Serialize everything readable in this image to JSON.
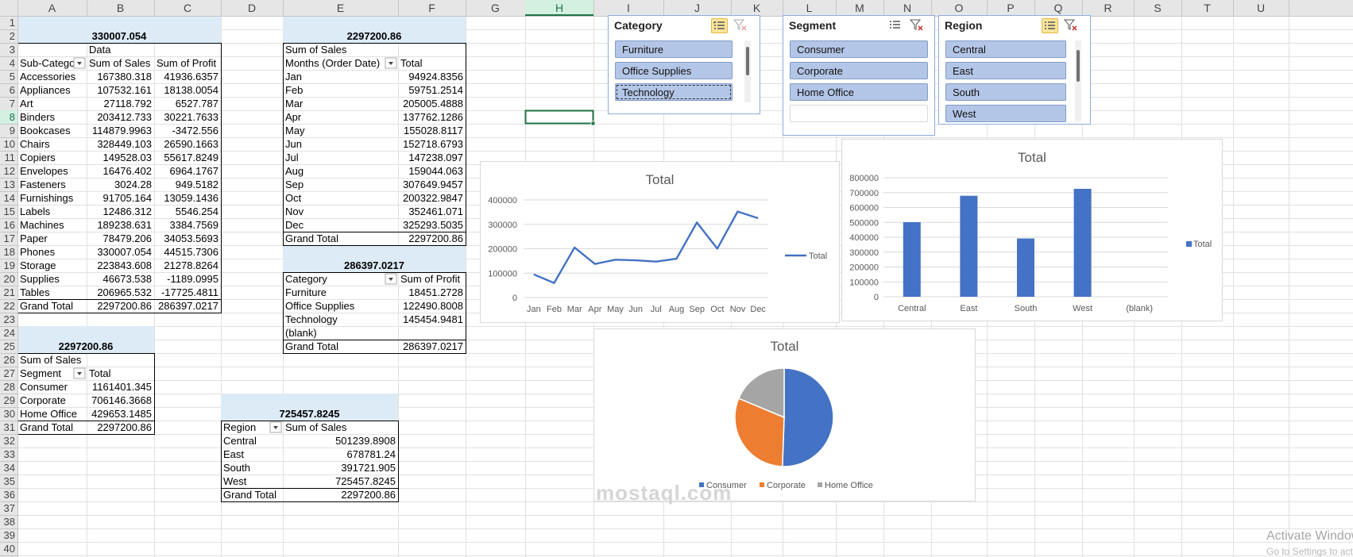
{
  "columns": [
    "A",
    "B",
    "C",
    "D",
    "E",
    "F",
    "G",
    "H",
    "I",
    "J",
    "K",
    "L",
    "M",
    "N",
    "O",
    "P",
    "Q",
    "R",
    "S",
    "T",
    "U"
  ],
  "selected": {
    "column": "H",
    "row": 8
  },
  "cells": [
    {
      "c": "B",
      "r": 2,
      "v": "330007.054",
      "b": 1,
      "al": "c"
    },
    {
      "c": "B",
      "r": 3,
      "v": "Data"
    },
    {
      "c": "A",
      "r": 4,
      "v": "Sub-Catego"
    },
    {
      "c": "B",
      "r": 4,
      "v": "Sum of Sales"
    },
    {
      "c": "C",
      "r": 4,
      "v": "Sum of Profit"
    },
    {
      "c": "A",
      "r": 5,
      "v": "Accessories"
    },
    {
      "c": "B",
      "r": 5,
      "v": "167380.318",
      "al": "r"
    },
    {
      "c": "C",
      "r": 5,
      "v": "41936.6357",
      "al": "r"
    },
    {
      "c": "A",
      "r": 6,
      "v": "Appliances"
    },
    {
      "c": "B",
      "r": 6,
      "v": "107532.161",
      "al": "r"
    },
    {
      "c": "C",
      "r": 6,
      "v": "18138.0054",
      "al": "r"
    },
    {
      "c": "A",
      "r": 7,
      "v": "Art"
    },
    {
      "c": "B",
      "r": 7,
      "v": "27118.792",
      "al": "r"
    },
    {
      "c": "C",
      "r": 7,
      "v": "6527.787",
      "al": "r"
    },
    {
      "c": "A",
      "r": 8,
      "v": "Binders"
    },
    {
      "c": "B",
      "r": 8,
      "v": "203412.733",
      "al": "r"
    },
    {
      "c": "C",
      "r": 8,
      "v": "30221.7633",
      "al": "r"
    },
    {
      "c": "A",
      "r": 9,
      "v": "Bookcases"
    },
    {
      "c": "B",
      "r": 9,
      "v": "114879.9963",
      "al": "r"
    },
    {
      "c": "C",
      "r": 9,
      "v": "-3472.556",
      "al": "r"
    },
    {
      "c": "A",
      "r": 10,
      "v": "Chairs"
    },
    {
      "c": "B",
      "r": 10,
      "v": "328449.103",
      "al": "r"
    },
    {
      "c": "C",
      "r": 10,
      "v": "26590.1663",
      "al": "r"
    },
    {
      "c": "A",
      "r": 11,
      "v": "Copiers"
    },
    {
      "c": "B",
      "r": 11,
      "v": "149528.03",
      "al": "r"
    },
    {
      "c": "C",
      "r": 11,
      "v": "55617.8249",
      "al": "r"
    },
    {
      "c": "A",
      "r": 12,
      "v": "Envelopes"
    },
    {
      "c": "B",
      "r": 12,
      "v": "16476.402",
      "al": "r"
    },
    {
      "c": "C",
      "r": 12,
      "v": "6964.1767",
      "al": "r"
    },
    {
      "c": "A",
      "r": 13,
      "v": "Fasteners"
    },
    {
      "c": "B",
      "r": 13,
      "v": "3024.28",
      "al": "r"
    },
    {
      "c": "C",
      "r": 13,
      "v": "949.5182",
      "al": "r"
    },
    {
      "c": "A",
      "r": 14,
      "v": "Furnishings"
    },
    {
      "c": "B",
      "r": 14,
      "v": "91705.164",
      "al": "r"
    },
    {
      "c": "C",
      "r": 14,
      "v": "13059.1436",
      "al": "r"
    },
    {
      "c": "A",
      "r": 15,
      "v": "Labels"
    },
    {
      "c": "B",
      "r": 15,
      "v": "12486.312",
      "al": "r"
    },
    {
      "c": "C",
      "r": 15,
      "v": "5546.254",
      "al": "r"
    },
    {
      "c": "A",
      "r": 16,
      "v": "Machines"
    },
    {
      "c": "B",
      "r": 16,
      "v": "189238.631",
      "al": "r"
    },
    {
      "c": "C",
      "r": 16,
      "v": "3384.7569",
      "al": "r"
    },
    {
      "c": "A",
      "r": 17,
      "v": "Paper"
    },
    {
      "c": "B",
      "r": 17,
      "v": "78479.206",
      "al": "r"
    },
    {
      "c": "C",
      "r": 17,
      "v": "34053.5693",
      "al": "r"
    },
    {
      "c": "A",
      "r": 18,
      "v": "Phones"
    },
    {
      "c": "B",
      "r": 18,
      "v": "330007.054",
      "al": "r"
    },
    {
      "c": "C",
      "r": 18,
      "v": "44515.7306",
      "al": "r"
    },
    {
      "c": "A",
      "r": 19,
      "v": "Storage"
    },
    {
      "c": "B",
      "r": 19,
      "v": "223843.608",
      "al": "r"
    },
    {
      "c": "C",
      "r": 19,
      "v": "21278.8264",
      "al": "r"
    },
    {
      "c": "A",
      "r": 20,
      "v": "Supplies"
    },
    {
      "c": "B",
      "r": 20,
      "v": "46673.538",
      "al": "r"
    },
    {
      "c": "C",
      "r": 20,
      "v": "-1189.0995",
      "al": "r"
    },
    {
      "c": "A",
      "r": 21,
      "v": "Tables"
    },
    {
      "c": "B",
      "r": 21,
      "v": "206965.532",
      "al": "r"
    },
    {
      "c": "C",
      "r": 21,
      "v": "-17725.4811",
      "al": "r"
    },
    {
      "c": "A",
      "r": 22,
      "v": "Grand Total"
    },
    {
      "c": "B",
      "r": 22,
      "v": "2297200.86",
      "al": "r"
    },
    {
      "c": "C",
      "r": 22,
      "v": "286397.0217",
      "al": "r"
    },
    {
      "c": "B",
      "r": 25,
      "v": "2297200.86",
      "b": 1,
      "al": "c"
    },
    {
      "c": "A",
      "r": 26,
      "v": "Sum of Sales"
    },
    {
      "c": "A",
      "r": 27,
      "v": "Segment"
    },
    {
      "c": "B",
      "r": 27,
      "v": "Total"
    },
    {
      "c": "A",
      "r": 28,
      "v": "Consumer"
    },
    {
      "c": "B",
      "r": 28,
      "v": "1161401.345",
      "al": "r"
    },
    {
      "c": "A",
      "r": 29,
      "v": "Corporate"
    },
    {
      "c": "B",
      "r": 29,
      "v": "706146.3668",
      "al": "r"
    },
    {
      "c": "A",
      "r": 30,
      "v": "Home Office"
    },
    {
      "c": "B",
      "r": 30,
      "v": "429653.1485",
      "al": "r"
    },
    {
      "c": "A",
      "r": 31,
      "v": "Grand Total"
    },
    {
      "c": "B",
      "r": 31,
      "v": "2297200.86",
      "al": "r"
    },
    {
      "c": "F",
      "r": 2,
      "v": "2297200.86",
      "b": 1,
      "al": "c"
    },
    {
      "c": "E",
      "r": 3,
      "v": "Sum of Sales"
    },
    {
      "c": "E",
      "r": 4,
      "v": "Months (Order Date)"
    },
    {
      "c": "F",
      "r": 4,
      "v": "Total"
    },
    {
      "c": "E",
      "r": 5,
      "v": "Jan"
    },
    {
      "c": "F",
      "r": 5,
      "v": "94924.8356",
      "al": "r"
    },
    {
      "c": "E",
      "r": 6,
      "v": "Feb"
    },
    {
      "c": "F",
      "r": 6,
      "v": "59751.2514",
      "al": "r"
    },
    {
      "c": "E",
      "r": 7,
      "v": "Mar"
    },
    {
      "c": "F",
      "r": 7,
      "v": "205005.4888",
      "al": "r"
    },
    {
      "c": "E",
      "r": 8,
      "v": "Apr"
    },
    {
      "c": "F",
      "r": 8,
      "v": "137762.1286",
      "al": "r"
    },
    {
      "c": "E",
      "r": 9,
      "v": "May"
    },
    {
      "c": "F",
      "r": 9,
      "v": "155028.8117",
      "al": "r"
    },
    {
      "c": "E",
      "r": 10,
      "v": "Jun"
    },
    {
      "c": "F",
      "r": 10,
      "v": "152718.6793",
      "al": "r"
    },
    {
      "c": "E",
      "r": 11,
      "v": "Jul"
    },
    {
      "c": "F",
      "r": 11,
      "v": "147238.097",
      "al": "r"
    },
    {
      "c": "E",
      "r": 12,
      "v": "Aug"
    },
    {
      "c": "F",
      "r": 12,
      "v": "159044.063",
      "al": "r"
    },
    {
      "c": "E",
      "r": 13,
      "v": "Sep"
    },
    {
      "c": "F",
      "r": 13,
      "v": "307649.9457",
      "al": "r"
    },
    {
      "c": "E",
      "r": 14,
      "v": "Oct"
    },
    {
      "c": "F",
      "r": 14,
      "v": "200322.9847",
      "al": "r"
    },
    {
      "c": "E",
      "r": 15,
      "v": "Nov"
    },
    {
      "c": "F",
      "r": 15,
      "v": "352461.071",
      "al": "r"
    },
    {
      "c": "E",
      "r": 16,
      "v": "Dec"
    },
    {
      "c": "F",
      "r": 16,
      "v": "325293.5035",
      "al": "r"
    },
    {
      "c": "E",
      "r": 17,
      "v": "Grand Total"
    },
    {
      "c": "F",
      "r": 17,
      "v": "2297200.86",
      "al": "r"
    },
    {
      "c": "F",
      "r": 19,
      "v": "286397.0217",
      "b": 1,
      "al": "c"
    },
    {
      "c": "E",
      "r": 20,
      "v": "Category"
    },
    {
      "c": "F",
      "r": 20,
      "v": "Sum of Profit"
    },
    {
      "c": "E",
      "r": 21,
      "v": "Furniture"
    },
    {
      "c": "F",
      "r": 21,
      "v": "18451.2728",
      "al": "r"
    },
    {
      "c": "E",
      "r": 22,
      "v": "Office Supplies"
    },
    {
      "c": "F",
      "r": 22,
      "v": "122490.8008",
      "al": "r"
    },
    {
      "c": "E",
      "r": 23,
      "v": "Technology"
    },
    {
      "c": "F",
      "r": 23,
      "v": "145454.9481",
      "al": "r"
    },
    {
      "c": "E",
      "r": 24,
      "v": "(blank)"
    },
    {
      "c": "E",
      "r": 25,
      "v": "Grand Total"
    },
    {
      "c": "F",
      "r": 25,
      "v": "286397.0217",
      "al": "r"
    },
    {
      "c": "E",
      "r": 30,
      "v": "725457.8245",
      "b": 1,
      "al": "c"
    },
    {
      "c": "D",
      "r": 31,
      "v": "Region"
    },
    {
      "c": "E",
      "r": 31,
      "v": "Sum of Sales"
    },
    {
      "c": "D",
      "r": 32,
      "v": "Central"
    },
    {
      "c": "E",
      "r": 32,
      "v": "501239.8908",
      "al": "r"
    },
    {
      "c": "D",
      "r": 33,
      "v": "East"
    },
    {
      "c": "E",
      "r": 33,
      "v": "678781.24",
      "al": "r"
    },
    {
      "c": "D",
      "r": 34,
      "v": "South"
    },
    {
      "c": "E",
      "r": 34,
      "v": "391721.905",
      "al": "r"
    },
    {
      "c": "D",
      "r": 35,
      "v": "West"
    },
    {
      "c": "E",
      "r": 35,
      "v": "725457.8245",
      "al": "r"
    },
    {
      "c": "D",
      "r": 36,
      "v": "Grand Total"
    },
    {
      "c": "E",
      "r": 36,
      "v": "2297200.86",
      "al": "r"
    }
  ],
  "slicers": {
    "category": {
      "title": "Category",
      "items": [
        "Furniture",
        "Office Supplies",
        "Technology"
      ],
      "filter_active": false,
      "focused_item": "Technology"
    },
    "segment": {
      "title": "Segment",
      "items": [
        "Consumer",
        "Corporate",
        "Home Office"
      ],
      "filter_active": true
    },
    "region": {
      "title": "Region",
      "items": [
        "Central",
        "East",
        "South",
        "West"
      ],
      "filter_active": false
    }
  },
  "icons": {
    "multi_select": "multi-select-icon",
    "clear_filter": "clear-filter-icon",
    "dropdown": "dropdown-arrow-icon",
    "filter": "filter-funnel-icon"
  },
  "colors": {
    "grid": "#e1e1e1",
    "header_bg": "#e6e6e6",
    "pivot_header": "#ddebf7",
    "selection": "#217346",
    "slicer_item": "#b4c6e7",
    "series_blue": "#4472c4",
    "series_orange": "#ed7d31",
    "series_gray": "#a5a5a5"
  },
  "chart_data": [
    {
      "type": "line",
      "title": "Total",
      "categories": [
        "Jan",
        "Feb",
        "Mar",
        "Apr",
        "May",
        "Jun",
        "Jul",
        "Aug",
        "Sep",
        "Oct",
        "Nov",
        "Dec"
      ],
      "series": [
        {
          "name": "Total",
          "values": [
            94924.8356,
            59751.2514,
            205005.4888,
            137762.1286,
            155028.8117,
            152718.6793,
            147238.097,
            159044.063,
            307649.9457,
            200322.9847,
            352461.071,
            325293.5035
          ]
        }
      ],
      "ylim": [
        0,
        400000
      ],
      "yticks": [
        "0",
        "100000",
        "200000",
        "300000",
        "400000"
      ],
      "grid": true,
      "legend": "right"
    },
    {
      "type": "bar",
      "title": "Total",
      "categories": [
        "Central",
        "East",
        "South",
        "West",
        "(blank)"
      ],
      "series": [
        {
          "name": "Total",
          "values": [
            501239.8908,
            678781.24,
            391721.905,
            725457.8245,
            0
          ]
        }
      ],
      "ylim": [
        0,
        800000
      ],
      "yticks": [
        "0",
        "100000",
        "200000",
        "300000",
        "400000",
        "500000",
        "600000",
        "700000",
        "800000"
      ],
      "grid": true,
      "legend": "right"
    },
    {
      "type": "pie",
      "title": "Total",
      "categories": [
        "Consumer",
        "Corporate",
        "Home Office"
      ],
      "values": [
        1161401.345,
        706146.3668,
        429653.1485
      ],
      "colors": [
        "#4472c4",
        "#ed7d31",
        "#a5a5a5"
      ],
      "legend": "bottom"
    }
  ],
  "watermark": "mostaql.com",
  "activation": {
    "line1": "Activate Windows",
    "line2": "Go to Settings to activate Windows."
  }
}
